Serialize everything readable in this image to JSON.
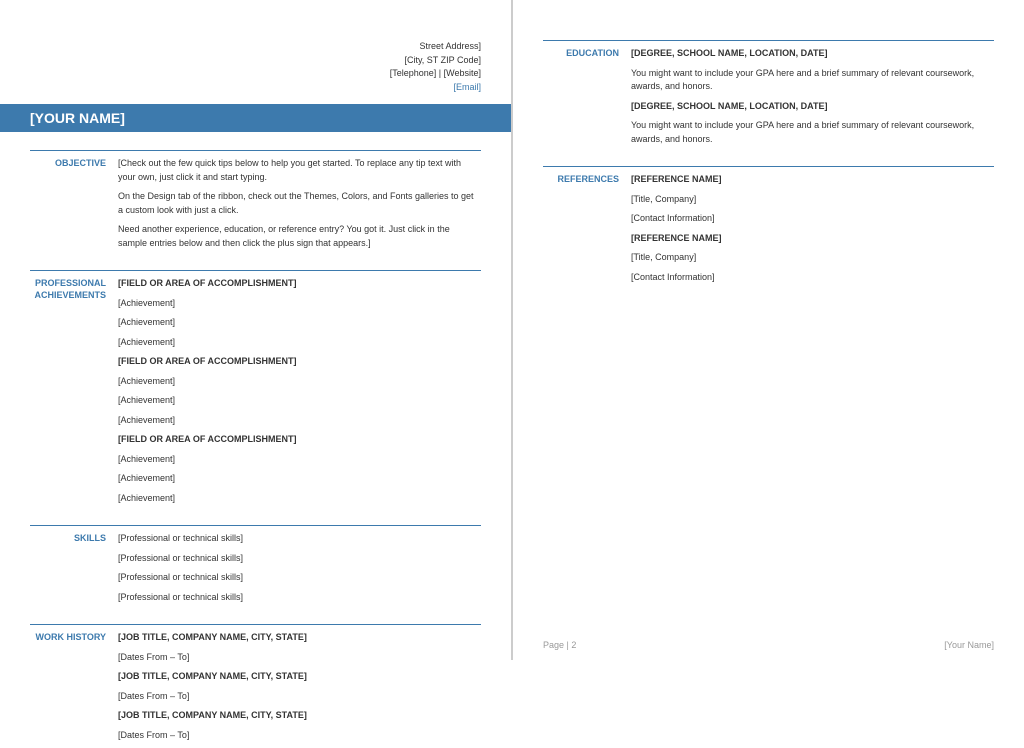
{
  "contact": {
    "street": "Street Address]",
    "citystate": "[City, ST ZIP Code]",
    "phone_site": "[Telephone] | [Website]",
    "email": "[Email]"
  },
  "name": "[YOUR NAME]",
  "objective": {
    "label": "OBJECTIVE",
    "p1": "[Check out the few quick tips below to help you get started. To replace any tip text with your own, just click it and start typing.",
    "p2": "On the Design tab of the ribbon, check out the Themes, Colors, and Fonts galleries to get a custom look with just a click.",
    "p3": "Need another experience, education, or reference entry? You got it. Just click in the sample entries below and then click the plus sign that appears.]"
  },
  "achievements": {
    "label_l1": "PROFESSIONAL",
    "label_l2": "ACHIEVEMENTS",
    "field": "[FIELD OR AREA OF ACCOMPLISHMENT]",
    "item": "[Achievement]"
  },
  "skills": {
    "label": "SKILLS",
    "item": "[Professional or technical skills]"
  },
  "work": {
    "label": "WORK HISTORY",
    "job": "[JOB TITLE, COMPANY NAME, CITY, STATE]",
    "dates": "[Dates From – To]"
  },
  "education": {
    "label": "EDUCATION",
    "degree": "[DEGREE, SCHOOL NAME, LOCATION, DATE]",
    "desc": "You might want to include your GPA here and a brief summary of relevant coursework, awards, and honors."
  },
  "references": {
    "label": "REFERENCES",
    "name": "[REFERENCE NAME]",
    "title": "[Title, Company]",
    "contact": "[Contact Information]"
  },
  "footer": {
    "page": "Page | 2",
    "name": "[Your Name]"
  }
}
